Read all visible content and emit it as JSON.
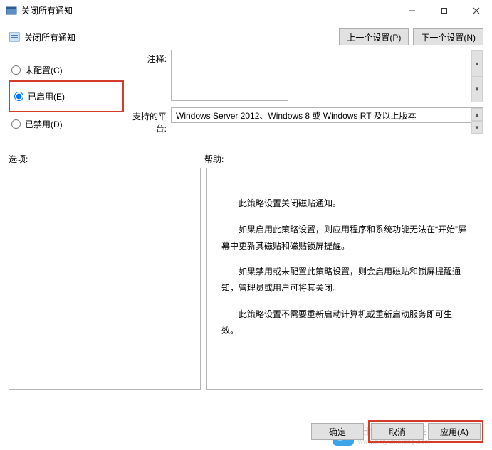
{
  "window": {
    "title": "关闭所有通知"
  },
  "header": {
    "title": "关闭所有通知",
    "prev_btn": "上一个设置(P)",
    "next_btn": "下一个设置(N)"
  },
  "radios": {
    "not_configured": "未配置(C)",
    "enabled": "已启用(E)",
    "disabled": "已禁用(D)",
    "selected": "enabled"
  },
  "fields": {
    "comment_label": "注释:",
    "comment_value": "",
    "platform_label": "支持的平台:",
    "platform_value": "Windows Server 2012、Windows 8 或 Windows RT 及以上版本"
  },
  "section_labels": {
    "options": "选项:",
    "help": "帮助:"
  },
  "help_text": {
    "p1": "此策略设置关闭磁贴通知。",
    "p2": "如果启用此策略设置，则应用程序和系统功能无法在“开始”屏幕中更新其磁贴和磁贴锁屏提醒。",
    "p3": "如果禁用或未配置此策略设置，则会启用磁贴和锁屏提醒通知，管理员或用户可将其关闭。",
    "p4": "此策略设置不需要重新启动计算机或重新启动服务即可生效。"
  },
  "footer": {
    "ok": "确定",
    "cancel": "取消",
    "apply": "应用(A)"
  },
  "watermark": {
    "line1": "白云一键重装系统",
    "line2": "www.baiyunxitong.com"
  }
}
